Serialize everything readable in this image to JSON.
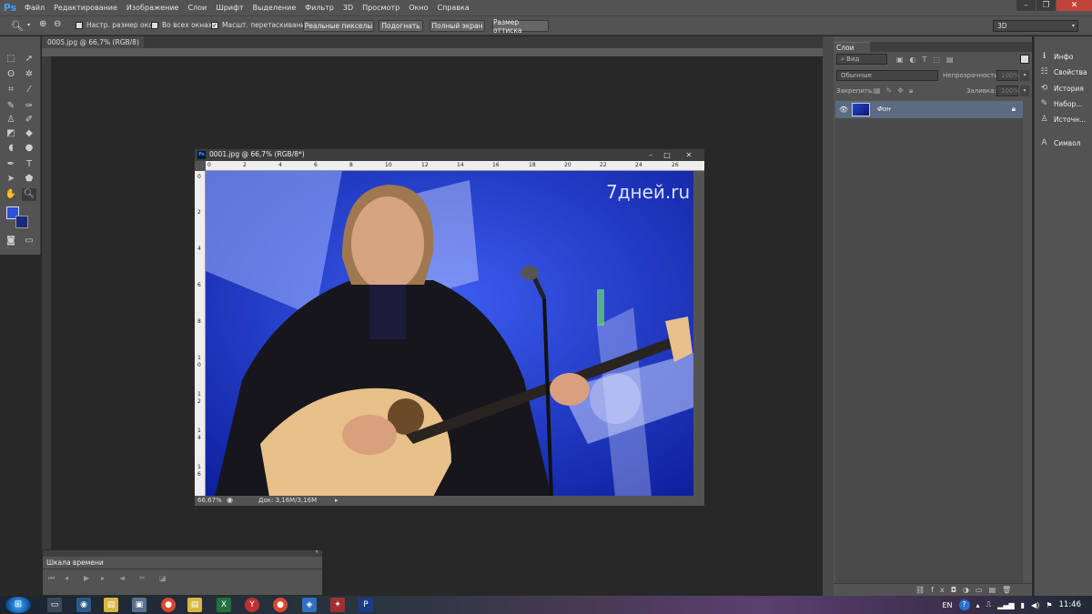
{
  "app": {
    "logo": "Ps"
  },
  "menu": [
    "Файл",
    "Редактирование",
    "Изображение",
    "Слои",
    "Шрифт",
    "Выделение",
    "Фильтр",
    "3D",
    "Просмотр",
    "Окно",
    "Справка"
  ],
  "options_bar": {
    "resize_windows_label": "Настр. размер окон",
    "all_windows_label": "Во всех окнах",
    "scrubby_zoom_label": "Масшт. перетаскиванием",
    "scrubby_zoom_checked_mark": "✓",
    "actual_pixels": "Реальные пикселы",
    "fit_screen": "Подогнать",
    "fill_screen": "Полный экран",
    "print_size": "Размер оттиска",
    "workspace": "3D"
  },
  "doc_tab": {
    "title": "0005.jpg @ 66,7% (RGB/8)",
    "close": "×"
  },
  "doc_window": {
    "title": "0001.jpg @ 66,7% (RGB/8*)",
    "ruler_h": [
      "0",
      "2",
      "4",
      "6",
      "8",
      "10",
      "12",
      "14",
      "16",
      "18",
      "20",
      "22",
      "24",
      "26"
    ],
    "ruler_v": [
      "0",
      "2",
      "4",
      "6",
      "8",
      "1 0",
      "1 2",
      "1 4",
      "1 6"
    ],
    "watermark": "7дней.ru",
    "zoom": "66,67%",
    "doc_size": "Док: 3,16M/3,16M"
  },
  "layers_panel": {
    "tab": "Слои",
    "filter_kind": "Вид",
    "blend_mode": "Обычные",
    "opacity_label": "Непрозрачность:",
    "opacity_value": "100%",
    "lock_label": "Закрепить:",
    "fill_label": "Заливка:",
    "fill_value": "100%",
    "layer_name": "Фон"
  },
  "side_dock": [
    "Инфо",
    "Свойства",
    "История",
    "Набор...",
    "Источн...",
    "Символ"
  ],
  "timeline": {
    "title": "Шкала времени"
  },
  "taskbar": {
    "lang": "EN",
    "time": "11:46"
  },
  "colors": {
    "accent": "#3fa0ff",
    "foreground": "#2f4fe0",
    "background": "#1a2a7a"
  }
}
